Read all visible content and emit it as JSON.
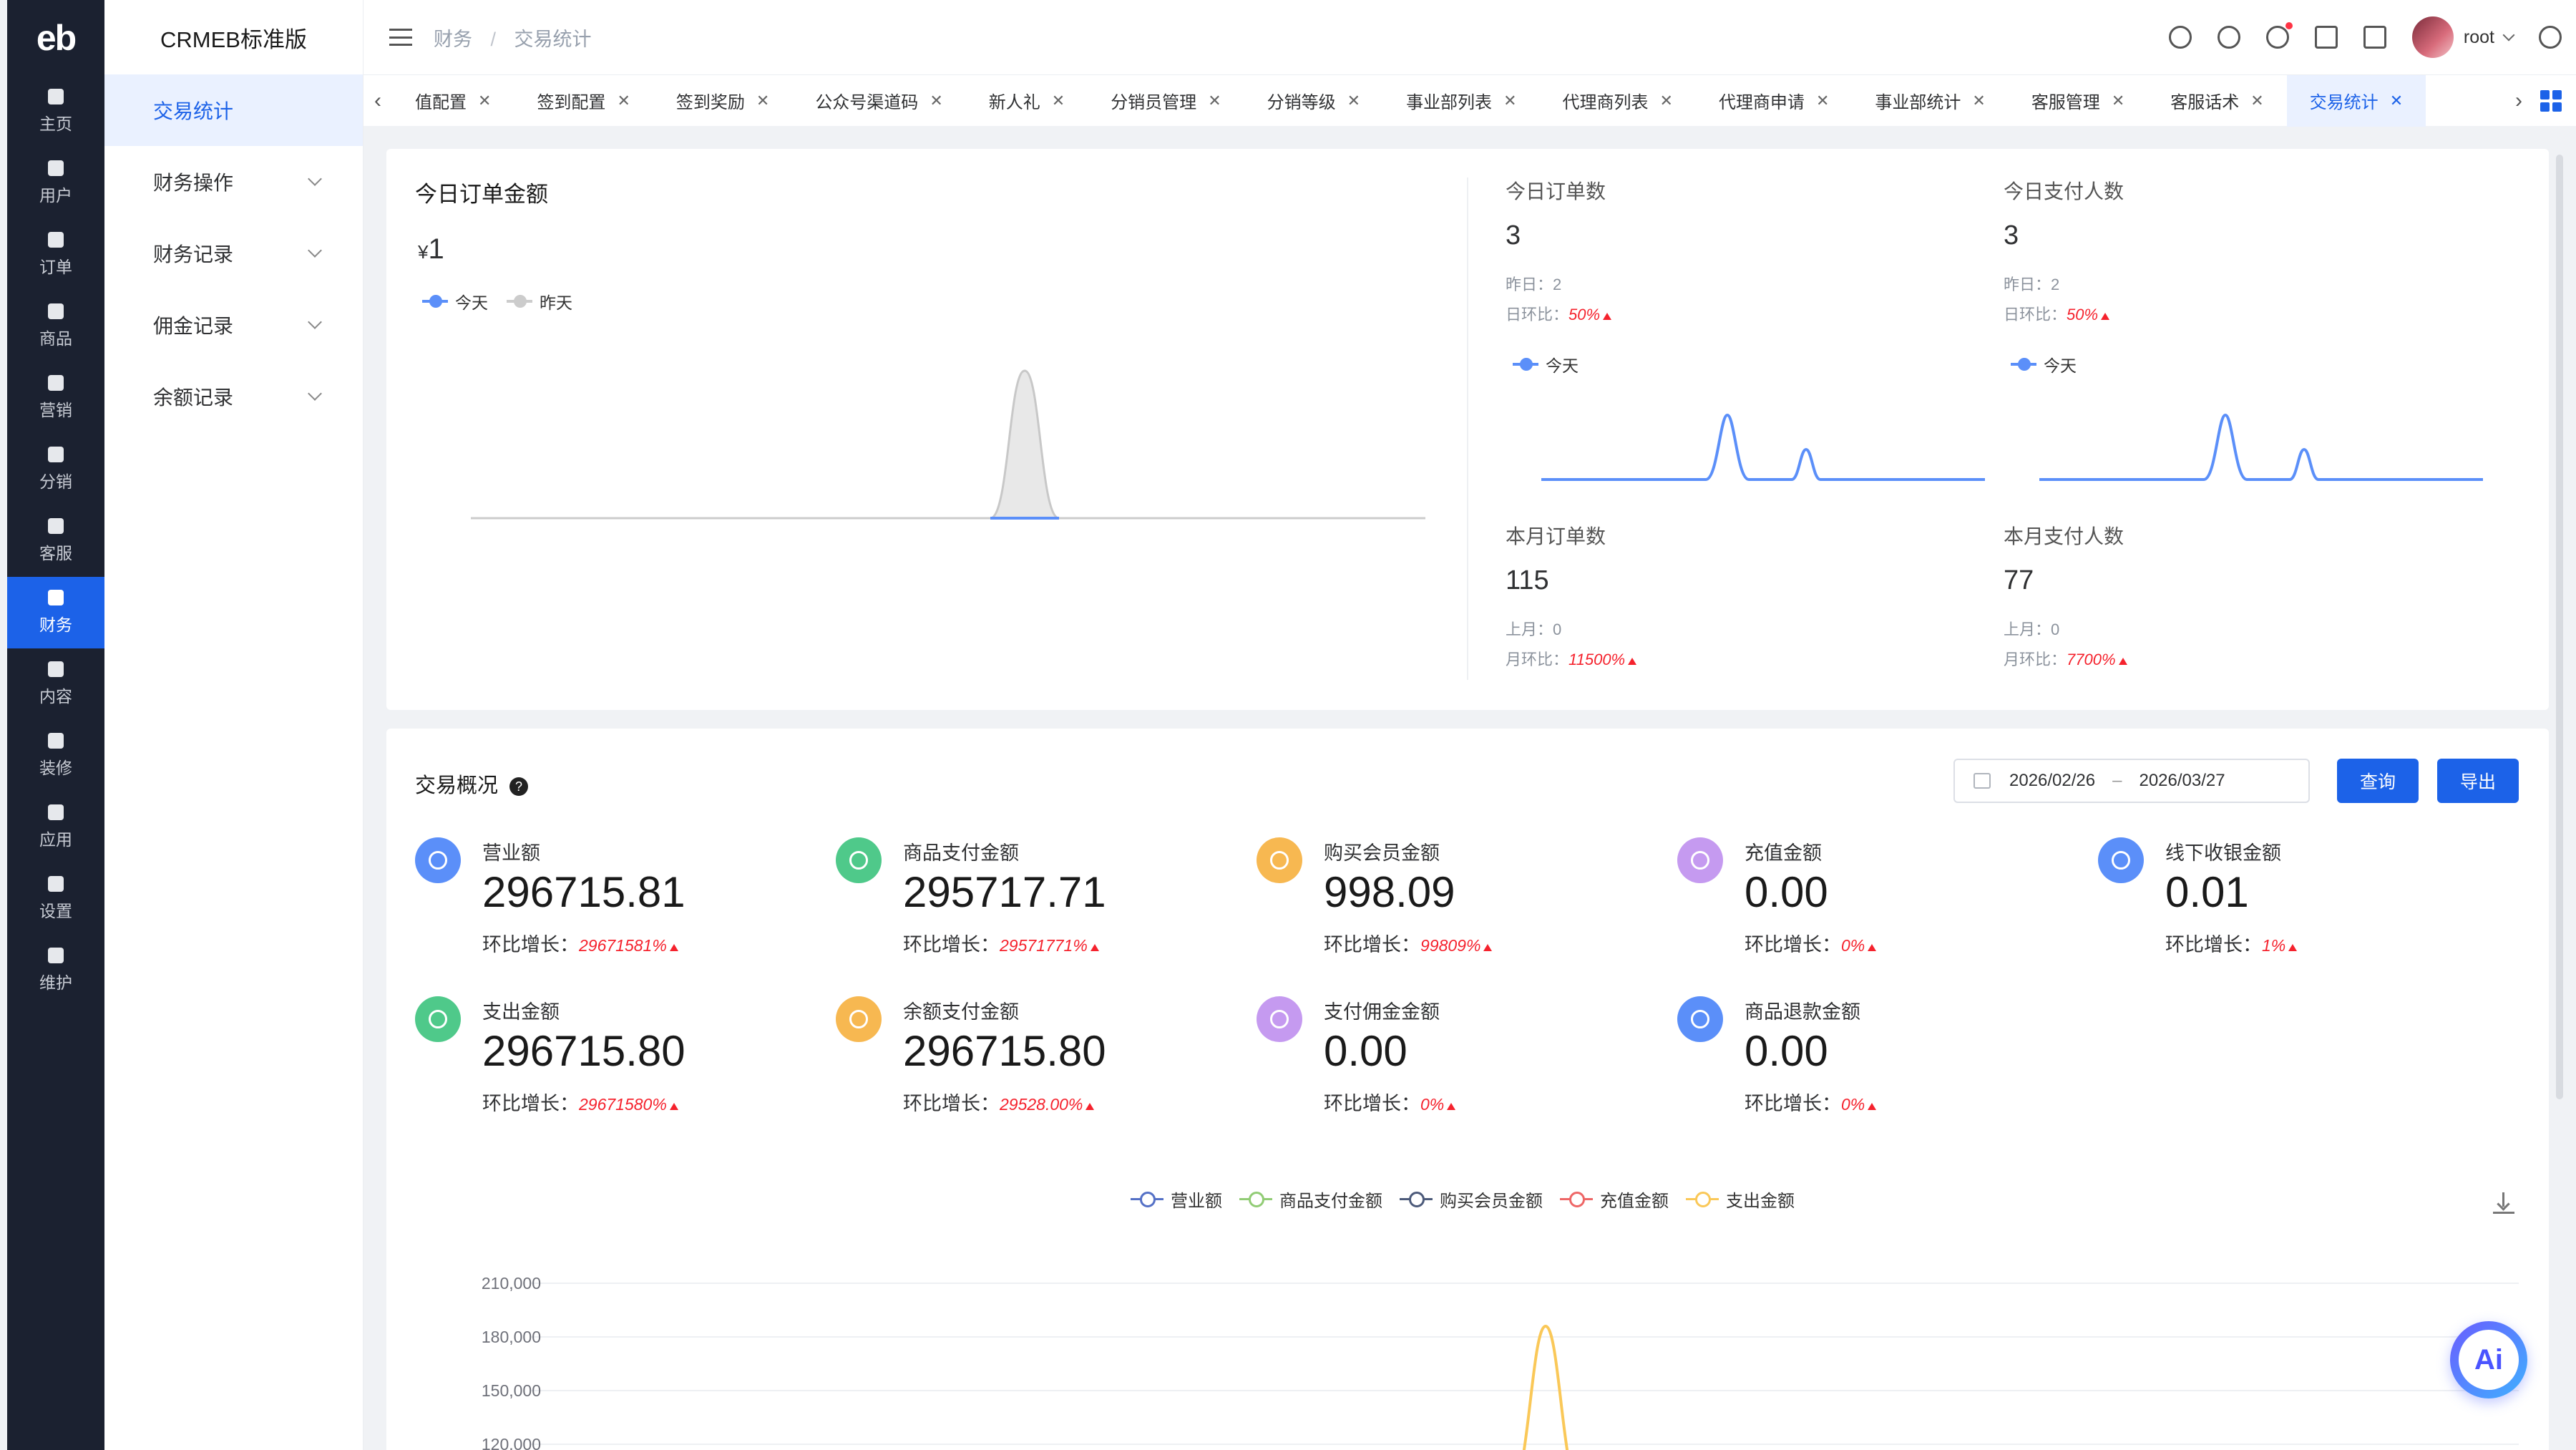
{
  "nav": {
    "logo": "eb",
    "items": [
      {
        "label": "主页",
        "active": false
      },
      {
        "label": "用户",
        "active": false
      },
      {
        "label": "订单",
        "active": false
      },
      {
        "label": "商品",
        "active": false
      },
      {
        "label": "营销",
        "active": false
      },
      {
        "label": "分销",
        "active": false
      },
      {
        "label": "客服",
        "active": false
      },
      {
        "label": "财务",
        "active": true
      },
      {
        "label": "内容",
        "active": false
      },
      {
        "label": "装修",
        "active": false
      },
      {
        "label": "应用",
        "active": false
      },
      {
        "label": "设置",
        "active": false
      },
      {
        "label": "维护",
        "active": false
      }
    ]
  },
  "submenu": {
    "brand": "CRMEB标准版",
    "items": [
      {
        "label": "交易统计",
        "active": true
      },
      {
        "label": "财务操作"
      },
      {
        "label": "财务记录"
      },
      {
        "label": "佣金记录"
      },
      {
        "label": "余额记录"
      }
    ]
  },
  "header": {
    "breadcrumb": [
      "财务",
      "交易统计"
    ],
    "user": "root"
  },
  "tabs": [
    {
      "label": "值配置"
    },
    {
      "label": "签到配置"
    },
    {
      "label": "签到奖励"
    },
    {
      "label": "公众号渠道码"
    },
    {
      "label": "新人礼"
    },
    {
      "label": "分销员管理"
    },
    {
      "label": "分销等级"
    },
    {
      "label": "事业部列表"
    },
    {
      "label": "代理商列表"
    },
    {
      "label": "代理商申请"
    },
    {
      "label": "事业部统计"
    },
    {
      "label": "客服管理"
    },
    {
      "label": "客服话术"
    },
    {
      "label": "交易统计",
      "active": true
    }
  ],
  "today": {
    "title": "今日订单金额",
    "currency": "¥",
    "amount": "1",
    "legend_today": "今天",
    "legend_yesterday": "昨天",
    "orders": {
      "title": "今日订单数",
      "value": "3",
      "prev_label": "昨日：",
      "prev": "2",
      "ratio_label": "日环比：",
      "ratio": "50%",
      "legend": "今天"
    },
    "payers": {
      "title": "今日支付人数",
      "value": "3",
      "prev_label": "昨日：",
      "prev": "2",
      "ratio_label": "日环比：",
      "ratio": "50%",
      "legend": "今天"
    },
    "month_orders": {
      "title": "本月订单数",
      "value": "115",
      "prev_label": "上月：",
      "prev": "0",
      "ratio_label": "月环比：",
      "ratio": "11500%"
    },
    "month_payers": {
      "title": "本月支付人数",
      "value": "77",
      "prev_label": "上月：",
      "prev": "0",
      "ratio_label": "月环比：",
      "ratio": "7700%"
    }
  },
  "overview": {
    "title": "交易概况",
    "help": "?",
    "date_start": "2026/02/26",
    "date_sep": "–",
    "date_end": "2026/03/27",
    "query_btn": "查询",
    "export_btn": "导出",
    "growth_label": "环比增长：",
    "stats": [
      {
        "label": "营业额",
        "value": "296715.81",
        "growth": "29671581%",
        "color": "#5b8ff9"
      },
      {
        "label": "商品支付金额",
        "value": "295717.71",
        "growth": "29571771%",
        "color": "#4fc98a"
      },
      {
        "label": "购买会员金额",
        "value": "998.09",
        "growth": "99809%",
        "color": "#f7b851"
      },
      {
        "label": "充值金额",
        "value": "0.00",
        "growth": "0%",
        "color": "#c59af0"
      },
      {
        "label": "线下收银金额",
        "value": "0.01",
        "growth": "1%",
        "color": "#5b8ff9"
      },
      {
        "label": "支出金额",
        "value": "296715.80",
        "growth": "29671580%",
        "color": "#4fc98a"
      },
      {
        "label": "余额支付金额",
        "value": "296715.80",
        "growth": "29528.00%",
        "color": "#f7b851"
      },
      {
        "label": "支付佣金金额",
        "value": "0.00",
        "growth": "0%",
        "color": "#c59af0"
      },
      {
        "label": "商品退款金额",
        "value": "0.00",
        "growth": "0%",
        "color": "#5b8ff9"
      }
    ],
    "chart_legend": [
      {
        "name": "营业额",
        "color": "#5470c6"
      },
      {
        "name": "商品支付金额",
        "color": "#91cc75"
      },
      {
        "name": "购买会员金额",
        "color": "#4c5a7a"
      },
      {
        "name": "充值金额",
        "color": "#ee6666"
      },
      {
        "name": "支出金额",
        "color": "#fac858"
      }
    ]
  },
  "chart_data": [
    {
      "type": "line",
      "legend": [
        "今天",
        "昨天"
      ],
      "series": [
        {
          "name": "今天",
          "color": "#5b8ff9"
        },
        {
          "name": "昨天",
          "color": "#cccccc"
        }
      ],
      "note": "single peak near the last third of the day"
    },
    {
      "type": "line",
      "title": "",
      "ylabel": "",
      "y_ticks": [
        120000,
        150000,
        180000,
        210000
      ],
      "y_tick_labels": [
        "120,000",
        "150,000",
        "180,000",
        "210,000"
      ],
      "legend_placement": "top",
      "series": [
        {
          "name": "营业额"
        },
        {
          "name": "商品支付金额"
        },
        {
          "name": "购买会员金额"
        },
        {
          "name": "充值金额"
        },
        {
          "name": "支出金额",
          "peak": 186000
        }
      ]
    }
  ]
}
